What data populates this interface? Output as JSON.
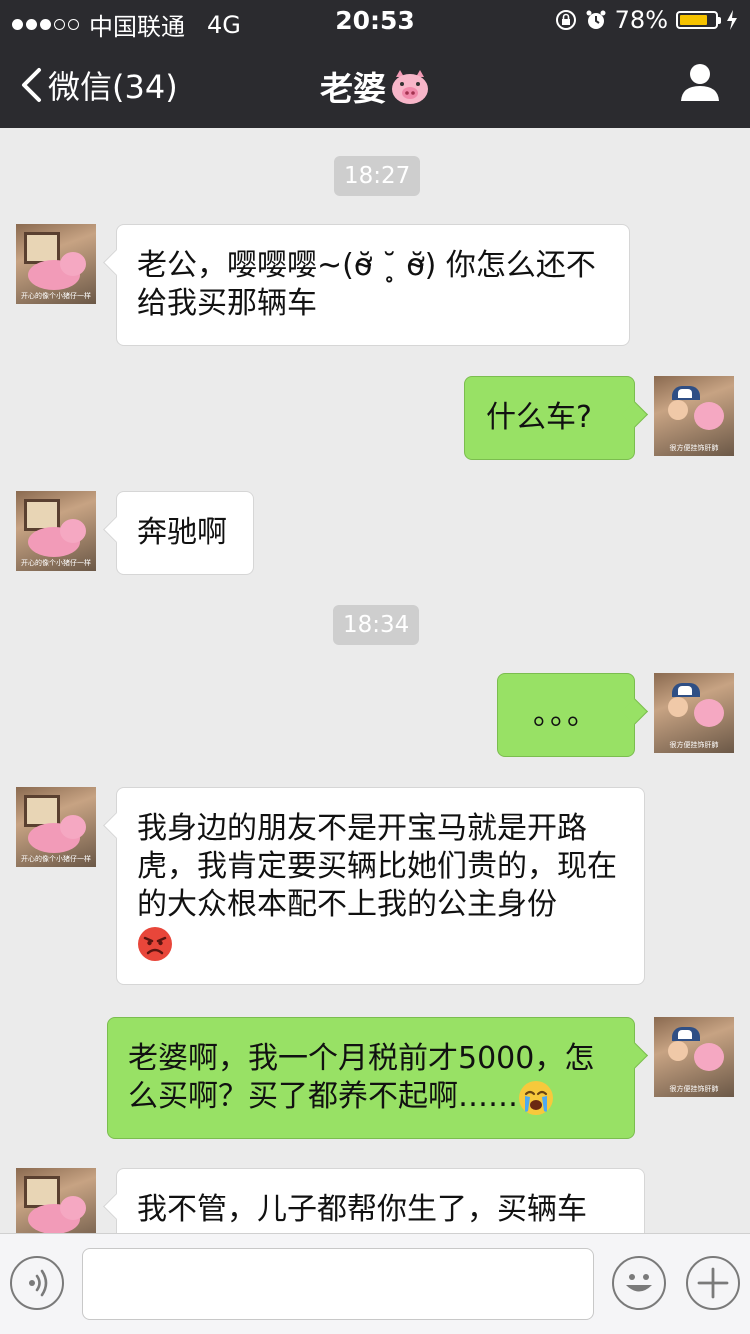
{
  "status_bar": {
    "carrier": "中国联通",
    "network": "4G",
    "time": "20:53",
    "battery": "78%",
    "battery_level": 0.78
  },
  "nav": {
    "back_label": "微信(34)",
    "title": "老婆",
    "title_emoji": "pig-face-icon"
  },
  "avatars": {
    "wife_caption": "开心的像个小猪仔一样",
    "me_caption": "很方便挂饰肝肺"
  },
  "messages": [
    {
      "type": "time",
      "text": "18:27"
    },
    {
      "type": "in",
      "text": "老公，嘤嘤嘤~(ơ̴̆ ˘̥ ơ̴̆) 你怎么还不给我买那辆车"
    },
    {
      "type": "out",
      "text": "什么车?"
    },
    {
      "type": "in",
      "text": "奔驰啊"
    },
    {
      "type": "time",
      "text": "18:34"
    },
    {
      "type": "out",
      "text": "。。。"
    },
    {
      "type": "in",
      "text": "我身边的朋友不是开宝马就是开路虎，我肯定要买辆比她们贵的，现在的大众根本配不上我的公主身份",
      "emoji": "angry-face-icon"
    },
    {
      "type": "out",
      "text": "老婆啊，我一个月税前才5000，怎么买啊？买了都养不起啊……",
      "emoji": "crying-face-icon"
    },
    {
      "type": "in",
      "text": "我不管，儿子都帮你生了，买辆车"
    }
  ],
  "input_bar": {
    "voice_icon": "voice-icon",
    "emoji_icon": "smiley-icon",
    "plus_icon": "plus-icon",
    "text_value": ""
  },
  "colors": {
    "nav_bg": "#2b2b2f",
    "chat_bg": "#ebebeb",
    "out_bubble": "#98e165",
    "in_bubble": "#ffffff",
    "battery": "#f6c300"
  }
}
